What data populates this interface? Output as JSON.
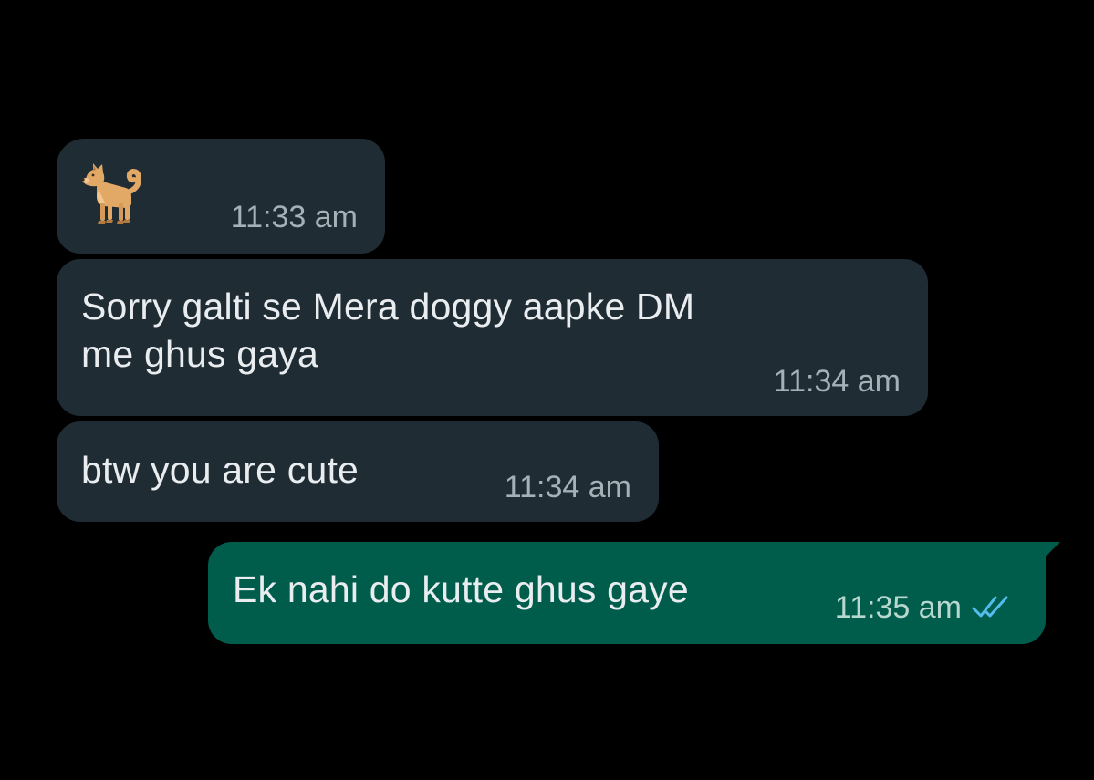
{
  "messages": [
    {
      "direction": "incoming",
      "content_emoji": "dog-emoji",
      "time": "11:33 am"
    },
    {
      "direction": "incoming",
      "text": "Sorry galti se Mera doggy aapke DM\nme ghus gaya",
      "time": "11:34 am"
    },
    {
      "direction": "incoming",
      "text": "btw you are cute",
      "time": "11:34 am"
    },
    {
      "direction": "outgoing",
      "text": "Ek nahi do kutte ghus gaye",
      "time": "11:35 am",
      "status_icon": "double-check-read-icon"
    }
  ],
  "colors": {
    "background": "#000000",
    "incoming_bubble": "#1f2c34",
    "outgoing_bubble": "#005c4b",
    "read_tick": "#53bdeb"
  }
}
